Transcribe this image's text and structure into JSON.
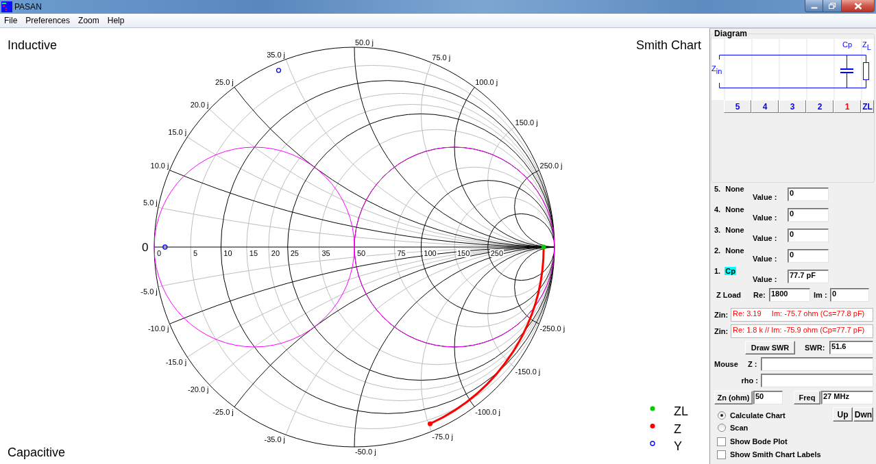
{
  "window": {
    "title": "PASAN"
  },
  "menu": [
    {
      "label": "File"
    },
    {
      "label": "Preferences"
    },
    {
      "label": "Zoom"
    },
    {
      "label": "Help"
    }
  ],
  "chart": {
    "top_left_label": "Inductive",
    "top_right_label": "Smith Chart",
    "bottom_left_label": "Capacitive",
    "axis_origin_label": "0",
    "resistance_labels": [
      "0",
      "5",
      "10",
      "15",
      "20",
      "25",
      "35",
      "50",
      "75",
      "100",
      "150",
      "250"
    ],
    "positive_reactance_labels": [
      "5.0 j",
      "10.0 j",
      "15.0 j",
      "20.0 j",
      "25.0 j",
      "35.0 j",
      "50.0 j",
      "75.0 j",
      "100.0 j",
      "150.0 j",
      "250.0 j"
    ],
    "negative_reactance_labels": [
      "-5.0 j",
      "-10.0 j",
      "-15.0 j",
      "-20.0 j",
      "-25.0 j",
      "-35.0 j",
      "-50.0 j",
      "-75.0 j",
      "-100.0 j",
      "-150.0 j",
      "-250.0 j"
    ],
    "legend": [
      {
        "label": "ZL",
        "kind": "dot",
        "color": "#00cc00"
      },
      {
        "label": "Z",
        "kind": "dot",
        "color": "#ff0000"
      },
      {
        "label": "Y",
        "kind": "ring",
        "color": "#0000ff"
      }
    ]
  },
  "diagram": {
    "title": "Diagram",
    "input_label": "Z$_{in}$",
    "element_label": "Cp",
    "load_label": "Z$_{L}$",
    "slots": [
      {
        "label": "5",
        "selected": false
      },
      {
        "label": "4",
        "selected": false
      },
      {
        "label": "3",
        "selected": false
      },
      {
        "label": "2",
        "selected": false
      },
      {
        "label": "1",
        "selected": true
      },
      {
        "label": "ZL",
        "selected": false
      }
    ]
  },
  "components": [
    {
      "number": "5.",
      "name": "None",
      "selected": false,
      "value_label": "Value :",
      "value": "0"
    },
    {
      "number": "4.",
      "name": "None",
      "selected": false,
      "value_label": "Value :",
      "value": "0"
    },
    {
      "number": "3.",
      "name": "None",
      "selected": false,
      "value_label": "Value :",
      "value": "0"
    },
    {
      "number": "2.",
      "name": "None",
      "selected": false,
      "value_label": "Value :",
      "value": "0"
    },
    {
      "number": "1.",
      "name": "Cp",
      "selected": true,
      "value_label": "Value :",
      "value": "77.7 pF"
    }
  ],
  "z_load": {
    "label": "Z Load",
    "re_label": "Re:",
    "re": "1800",
    "im_label": "Im :",
    "im": "0"
  },
  "zin": [
    {
      "label": "Zin:",
      "value": "Re: 3.19     Im: -75.7 ohm (Cs=77.8 pF)"
    },
    {
      "label": "Zin:",
      "value": "Re: 1.8 k // Im: -75.9 ohm (Cp=77.7 pF)"
    }
  ],
  "swr": {
    "button": "Draw SWR",
    "label": "SWR:",
    "value": "51.6"
  },
  "mouse": {
    "label": "Mouse",
    "z_label": "Z :",
    "rho_label": "rho :"
  },
  "zn": {
    "button": "Zn (ohm)",
    "value": "50"
  },
  "freq": {
    "button": "Freq",
    "value": "27 MHz"
  },
  "modes": [
    {
      "label": "Calculate Chart",
      "selected": true
    },
    {
      "label": "Scan",
      "selected": false
    }
  ],
  "step_buttons": [
    "Up",
    "Dwn"
  ],
  "options": [
    {
      "label": "Show Bode Plot",
      "checked": false
    },
    {
      "label": "Show Smith Chart Labels",
      "checked": false
    }
  ]
}
